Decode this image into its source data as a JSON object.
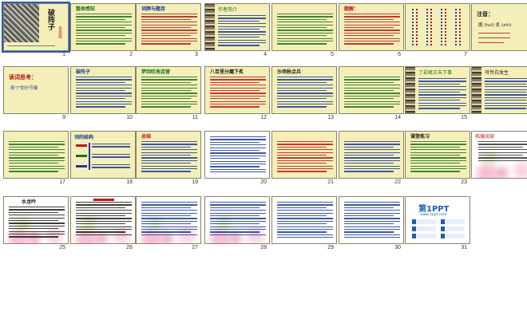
{
  "view": {
    "name": "slide-sorter"
  },
  "colors": {
    "cream": "#f4efb8",
    "beige": "#efe6c0",
    "white": "#ffffff",
    "text_blue": "#1a3a9a",
    "text_red": "#c0141a",
    "text_green": "#1f6e1f",
    "selection": "#2b57c8"
  },
  "slides": [
    {
      "num": "1",
      "title": "破阵子",
      "big_color": "#1a1a1a",
      "subtitle": "辛弃疾"
    },
    {
      "num": "2",
      "title": "整体感知",
      "title_color": "#1f6e1f"
    },
    {
      "num": "3",
      "title": "词牌与题目",
      "title_color": "#1a3a9a"
    },
    {
      "num": "4",
      "title": "作者简介",
      "title_color": "#1f6e1f"
    },
    {
      "num": "5",
      "title": "",
      "title_color": "#1a3a9a"
    },
    {
      "num": "6",
      "title": "题解：",
      "title_color": "#c0141a"
    },
    {
      "num": "7",
      "title": "",
      "title_color": "#1a3a9a"
    },
    {
      "num": "8",
      "title": "注音：",
      "title_color": "#1a1a1a",
      "note": "麾 (huī)  炙 (zhì)"
    },
    {
      "num": "9",
      "title": "读词思考：",
      "title_color": "#c0141a",
      "note": "用\"/\"划分节奏"
    },
    {
      "num": "10",
      "title": "破阵子",
      "title_color": "#1a3a9a"
    },
    {
      "num": "11",
      "title": "梦回吹角连营",
      "title_color": "#1f6e1f"
    },
    {
      "num": "12",
      "title": "八百里分麾下炙",
      "title_color": "#1a1a1a"
    },
    {
      "num": "13",
      "title": "沙场秋点兵",
      "title_color": "#1a1a1a"
    },
    {
      "num": "14",
      "title": "",
      "title_color": "#1a3a9a"
    },
    {
      "num": "15",
      "title": "了却君王天下事",
      "title_color": "#1f6e1f"
    },
    {
      "num": "16",
      "title": "可怜白发生",
      "title_color": "#1a1a1a"
    },
    {
      "num": "17",
      "title": "",
      "title_color": "#1a3a9a"
    },
    {
      "num": "18",
      "title": "词的结构",
      "title_color": "#1a3a9a"
    },
    {
      "num": "19",
      "title": "总结",
      "title_color": "#c0141a"
    },
    {
      "num": "20",
      "title": "",
      "title_color": "#1a3a9a"
    },
    {
      "num": "21",
      "title": "",
      "title_color": "#1a3a9a"
    },
    {
      "num": "22",
      "title": "",
      "title_color": "#1a3a9a"
    },
    {
      "num": "23",
      "title": "课堂练习",
      "title_color": "#1a1a1a"
    },
    {
      "num": "24",
      "title": "拓展阅读",
      "title_color": "#c0141a"
    },
    {
      "num": "25",
      "title": "水龙吟",
      "title_color": "#1a1a1a"
    },
    {
      "num": "26",
      "title": "",
      "title_color": "#c0141a"
    },
    {
      "num": "27",
      "title": "",
      "title_color": "#1a3a9a"
    },
    {
      "num": "28",
      "title": "",
      "title_color": "#1a3a9a"
    },
    {
      "num": "29",
      "title": "",
      "title_color": "#1a3a9a"
    },
    {
      "num": "30",
      "title": "",
      "title_color": "#1a3a9a"
    },
    {
      "num": "31",
      "title": "第1PPT",
      "title_color": "#1a5fb0",
      "note": "www.1ppt.com"
    }
  ]
}
